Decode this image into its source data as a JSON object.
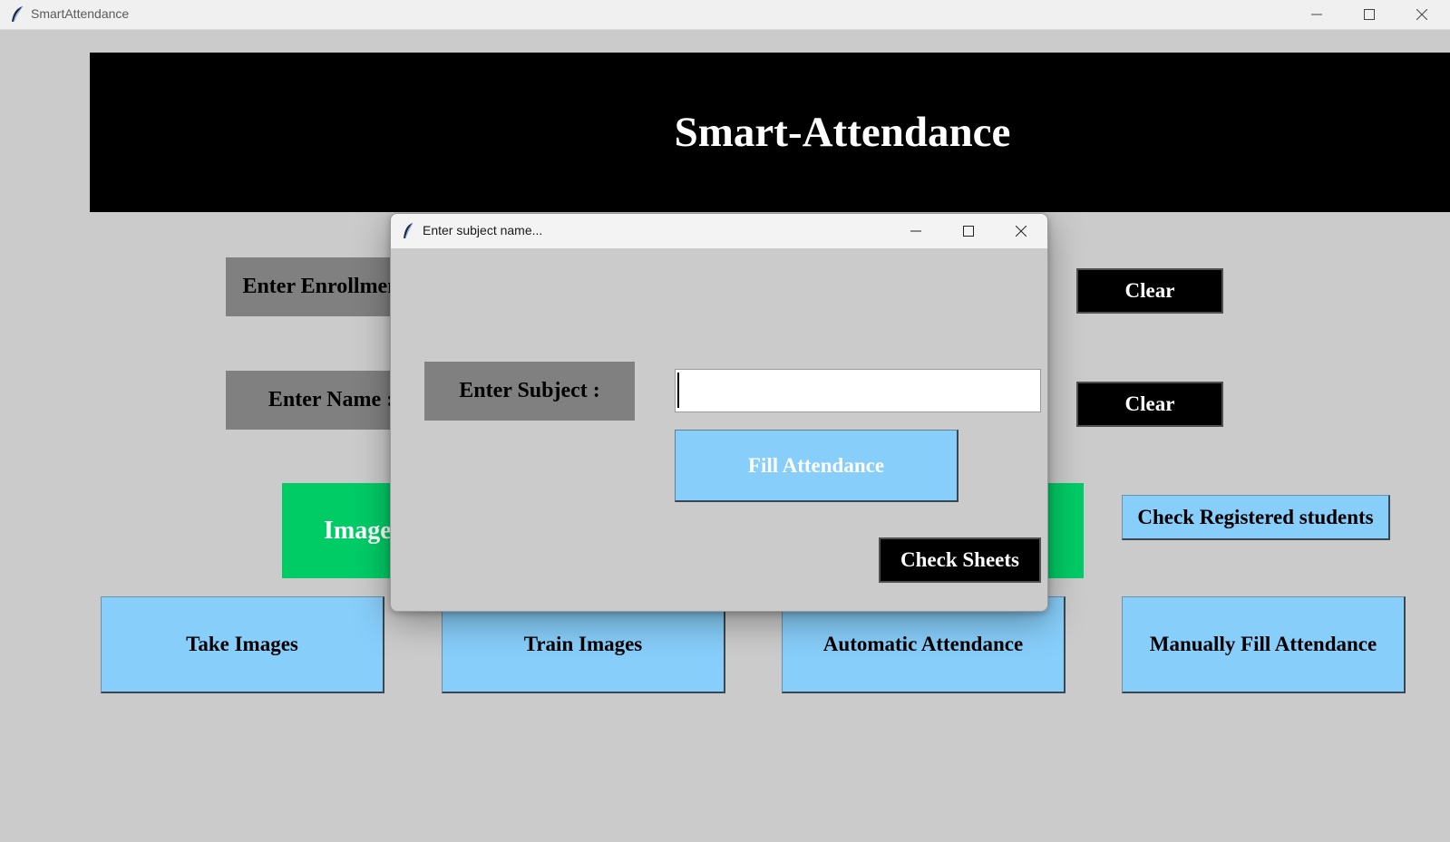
{
  "window": {
    "title": "SmartAttendance"
  },
  "header": {
    "title": "Smart-Attendance"
  },
  "form": {
    "enrollment_label": "Enter Enrollment :",
    "name_label": "Enter Name :",
    "clear_enrollment": "Clear",
    "clear_name": "Clear"
  },
  "notification": {
    "text": "Images Saved"
  },
  "buttons": {
    "check_registered": "Check Registered students",
    "take_images": "Take Images",
    "train_images": "Train Images",
    "automatic_attendance": "Automatic Attendance",
    "manual_attendance": "Manually Fill Attendance"
  },
  "dialog": {
    "title": "Enter subject name...",
    "subject_label": "Enter Subject :",
    "subject_value": "",
    "fill_attendance": "Fill Attendance",
    "check_sheets": "Check Sheets"
  },
  "colors": {
    "background": "#cbcbcb",
    "banner": "#000000",
    "label_gray": "#808080",
    "button_blue": "#87cefa",
    "notification_green": "#00cc66"
  }
}
